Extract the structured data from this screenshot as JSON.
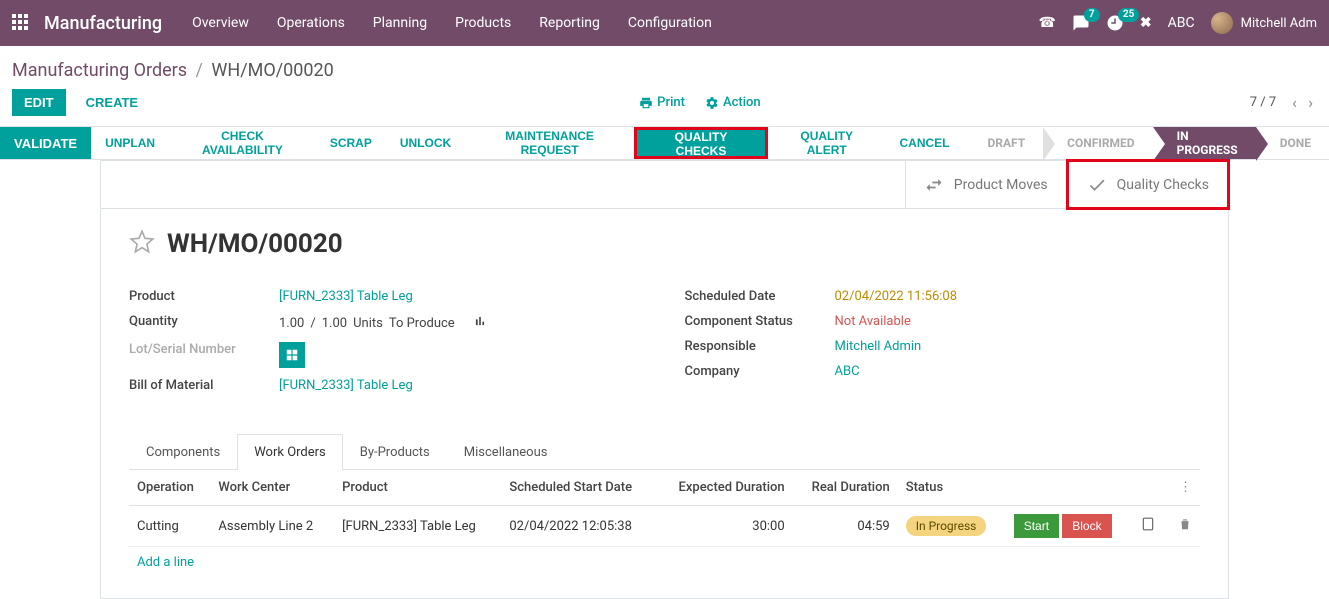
{
  "header": {
    "app_title": "Manufacturing",
    "menu": [
      "Overview",
      "Operations",
      "Planning",
      "Products",
      "Reporting",
      "Configuration"
    ],
    "chat_badge": "7",
    "clock_badge": "25",
    "company": "ABC",
    "user_name": "Mitchell Adm"
  },
  "breadcrumb": {
    "root": "Manufacturing Orders",
    "current": "WH/MO/00020"
  },
  "controls": {
    "edit": "EDIT",
    "create": "CREATE",
    "print": "Print",
    "action": "Action",
    "pager": "7 / 7"
  },
  "actions": {
    "validate": "VALIDATE",
    "unplan": "UNPLAN",
    "check_availability": "CHECK AVAILABILITY",
    "scrap": "SCRAP",
    "unlock": "UNLOCK",
    "maintenance": "MAINTENANCE REQUEST",
    "quality_checks": "QUALITY CHECKS",
    "quality_alert": "QUALITY ALERT",
    "cancel": "CANCEL"
  },
  "status_steps": [
    "DRAFT",
    "CONFIRMED",
    "IN PROGRESS",
    "DONE"
  ],
  "stat_buttons": {
    "product_moves": "Product Moves",
    "quality_checks": "Quality Checks"
  },
  "record": {
    "name": "WH/MO/00020",
    "product_label": "Product",
    "product_value": "[FURN_2333] Table Leg",
    "quantity_label": "Quantity",
    "quantity_done": "1.00",
    "quantity_sep": "/",
    "quantity_total": "1.00",
    "quantity_uom": "Units",
    "quantity_suffix": "To Produce",
    "lot_label": "Lot/Serial Number",
    "bom_label": "Bill of Material",
    "bom_value": "[FURN_2333] Table Leg",
    "scheduled_label": "Scheduled Date",
    "scheduled_value": "02/04/2022 11:56:08",
    "comp_status_label": "Component Status",
    "comp_status_value": "Not Available",
    "responsible_label": "Responsible",
    "responsible_value": "Mitchell Admin",
    "company_label": "Company",
    "company_value": "ABC"
  },
  "tabs": [
    "Components",
    "Work Orders",
    "By-Products",
    "Miscellaneous"
  ],
  "table": {
    "headers": {
      "operation": "Operation",
      "work_center": "Work Center",
      "product": "Product",
      "scheduled": "Scheduled Start Date",
      "expected": "Expected Duration",
      "real": "Real Duration",
      "status": "Status"
    },
    "rows": [
      {
        "operation": "Cutting",
        "work_center": "Assembly Line 2",
        "product": "[FURN_2333] Table Leg",
        "scheduled": "02/04/2022 12:05:38",
        "expected": "30:00",
        "real": "04:59",
        "status": "In Progress"
      }
    ],
    "start_btn": "Start",
    "block_btn": "Block",
    "add_line": "Add a line"
  }
}
